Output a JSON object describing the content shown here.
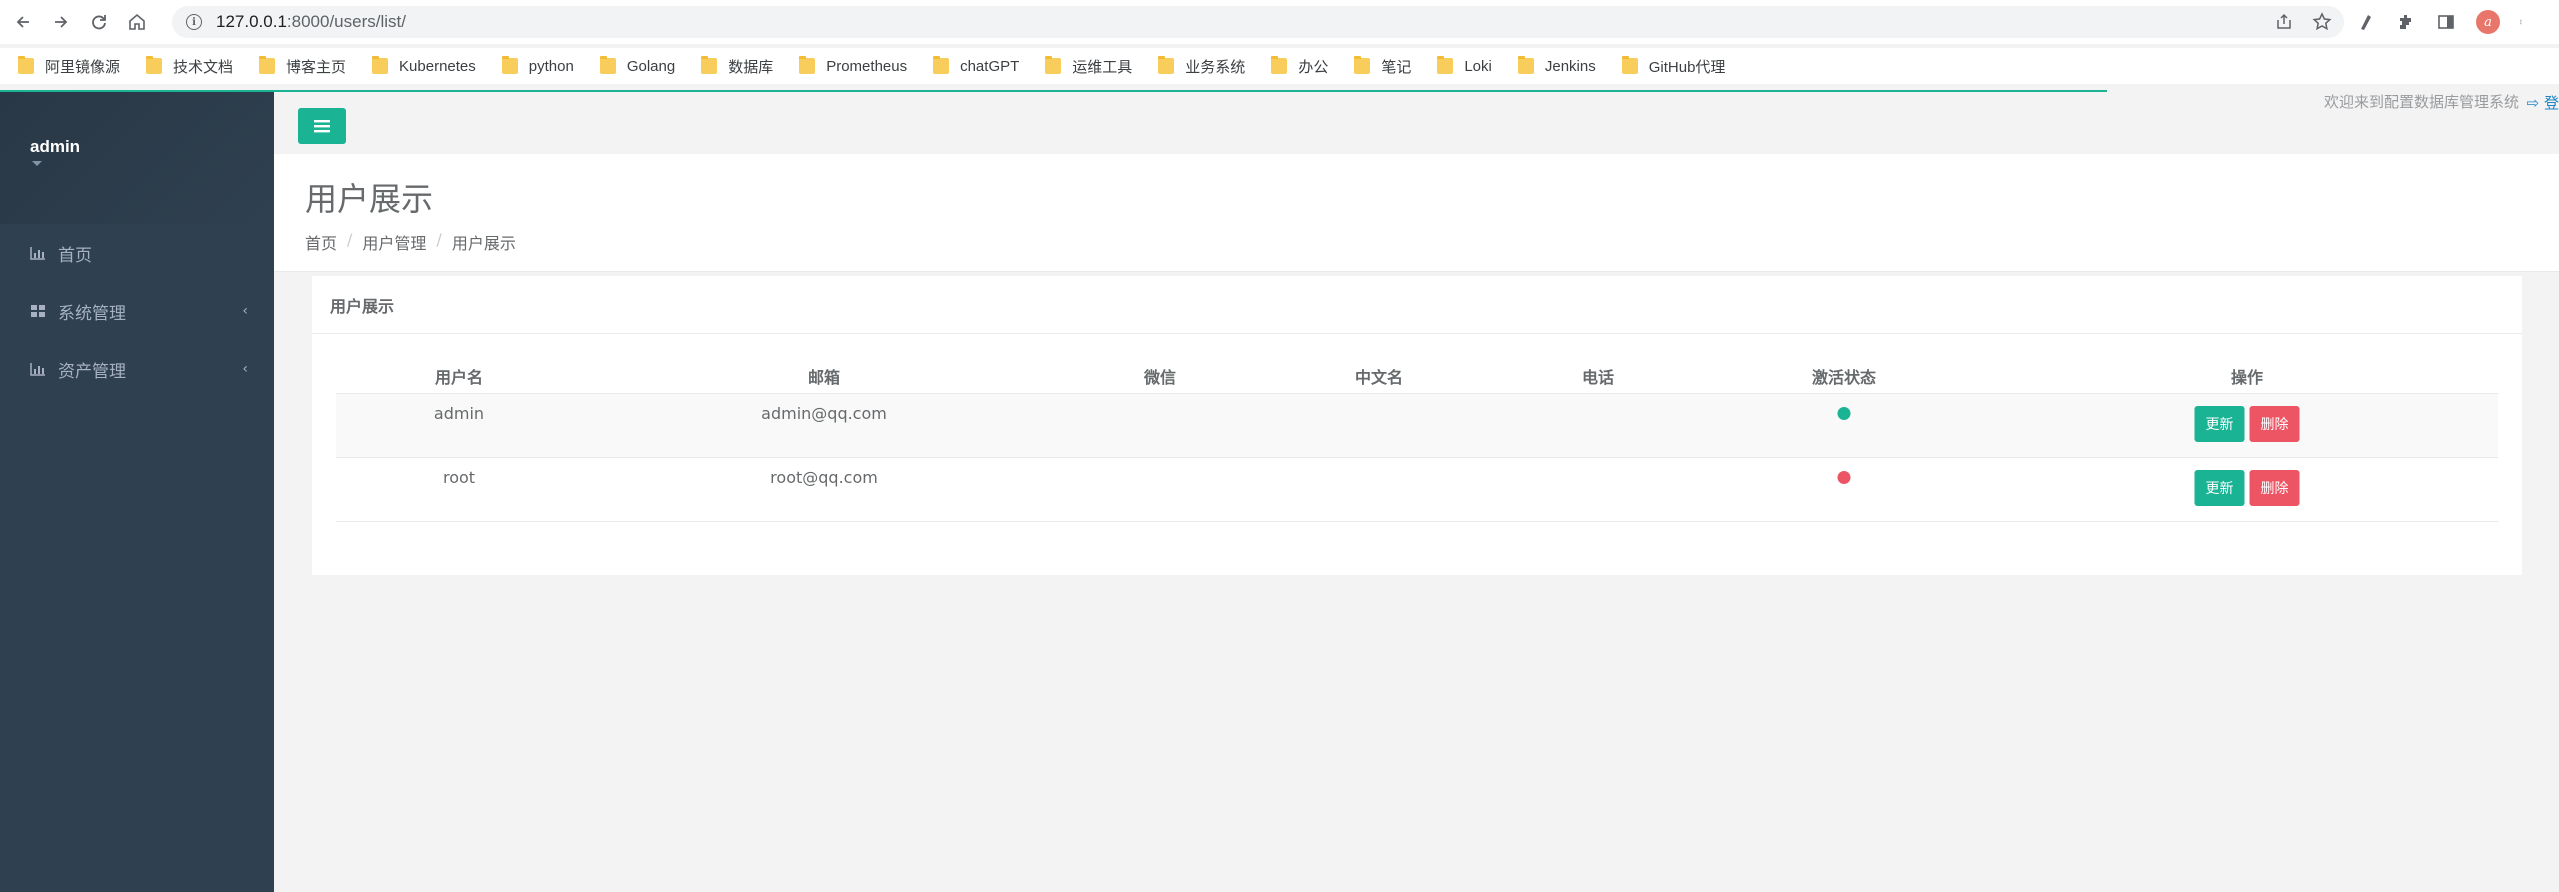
{
  "browser": {
    "url_host": "127.0.0.1",
    "url_rest": ":8000/users/list/"
  },
  "bookmarks": [
    "阿里镜像源",
    "技术文档",
    "博客主页",
    "Kubernetes",
    "python",
    "Golang",
    "数据库",
    "Prometheus",
    "chatGPT",
    "运维工具",
    "业务系统",
    "办公",
    "笔记",
    "Loki",
    "Jenkins",
    "GitHub代理"
  ],
  "sidebar": {
    "user": "admin",
    "items": [
      {
        "label": "首页",
        "icon": "bar-chart-icon",
        "has_children": false
      },
      {
        "label": "系统管理",
        "icon": "grid-icon",
        "has_children": true
      },
      {
        "label": "资产管理",
        "icon": "bar-chart-icon",
        "has_children": true
      }
    ],
    "chevron": "‹"
  },
  "topbar": {
    "welcome": "欢迎来到配置数据库管理系统",
    "logout_text": "登"
  },
  "heading": {
    "title": "用户展示",
    "breadcrumb": [
      "首页",
      "用户管理",
      "用户展示"
    ]
  },
  "panel": {
    "title": "用户展示",
    "columns": [
      "用户名",
      "邮箱",
      "微信",
      "中文名",
      "电话",
      "激活状态",
      "操作"
    ],
    "rows": [
      {
        "username": "admin",
        "email": "admin@qq.com",
        "wechat": "",
        "cn_name": "",
        "phone": "",
        "active": true,
        "status_color": "#1ab394"
      },
      {
        "username": "root",
        "email": "root@qq.com",
        "wechat": "",
        "cn_name": "",
        "phone": "",
        "active": false,
        "status_color": "#ed5565"
      }
    ],
    "update_label": "更新",
    "delete_label": "删除"
  },
  "colors": {
    "accent": "#1ab394",
    "danger": "#ed5565",
    "sidebar": "#2f4050"
  }
}
